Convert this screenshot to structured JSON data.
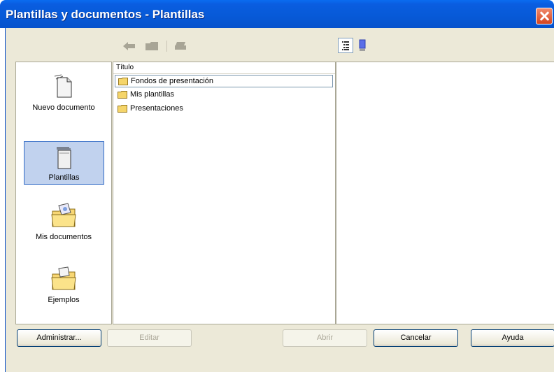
{
  "window": {
    "title": "Plantillas y documentos - Plantillas"
  },
  "toolbar": {
    "back_icon": "arrow-left-icon",
    "up_icon": "folder-up-icon",
    "print_icon": "print-icon",
    "view_icon": "list-view-icon",
    "preview_icon": "document-preview-icon"
  },
  "nav": {
    "items": [
      {
        "label": "Nuevo documento",
        "icon": "new-document-icon",
        "selected": false
      },
      {
        "label": "Plantillas",
        "icon": "templates-icon",
        "selected": true
      },
      {
        "label": "Mis documentos",
        "icon": "my-documents-folder-icon",
        "selected": false
      },
      {
        "label": "Ejemplos",
        "icon": "examples-folder-icon",
        "selected": false
      }
    ]
  },
  "list": {
    "column_header": "Título",
    "rows": [
      {
        "label": "Fondos de presentación",
        "icon": "folder-icon"
      },
      {
        "label": "Mis plantillas",
        "icon": "folder-icon"
      },
      {
        "label": "Presentaciones",
        "icon": "folder-icon"
      }
    ]
  },
  "buttons": {
    "admin": "Administrar...",
    "edit": "Editar",
    "open": "Abrir",
    "cancel": "Cancelar",
    "help": "Ayuda"
  },
  "colors": {
    "titlebar": "#0a5de0",
    "dialog_bg": "#ece9d8",
    "selection": "#c1d2ee",
    "close_button": "#d6451f"
  }
}
